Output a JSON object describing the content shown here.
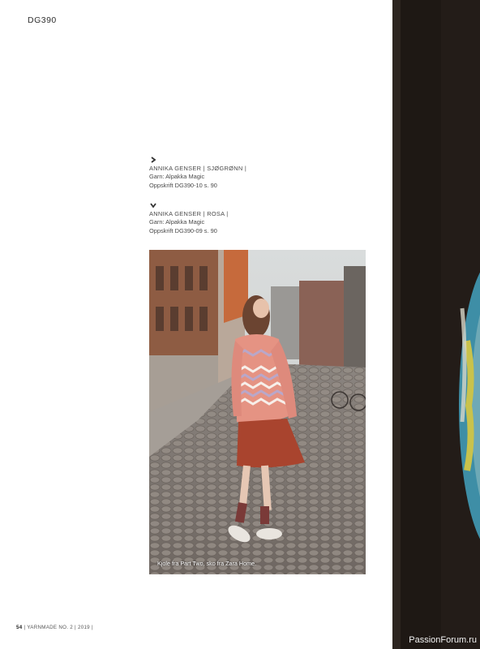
{
  "header": {
    "code": "DG390"
  },
  "captions": [
    {
      "direction": "right",
      "title": "ANNIKA GENSER | SJØGRØNN |",
      "yarn": "Garn: Alpakka Magic",
      "pattern": "Oppskrift DG390-10 s. 90"
    },
    {
      "direction": "down",
      "title": "ANNIKA GENSER | ROSA |",
      "yarn": "Garn: Alpakka Magic",
      "pattern": "Oppskrift DG390-09 s. 90"
    }
  ],
  "photo": {
    "caption": "Kjole fra Part Two, sko fra Zara Home."
  },
  "footer": {
    "page_number": "54",
    "publication": "| YARNMADE NO. 2 | 2019 |"
  },
  "watermark": "PassionForum.ru",
  "colors": {
    "sweater_pink": "#e59383",
    "sweater_lilac": "#b9a7c9",
    "skirt": "#a9442e",
    "right_photo_bg": "#1e1814"
  }
}
